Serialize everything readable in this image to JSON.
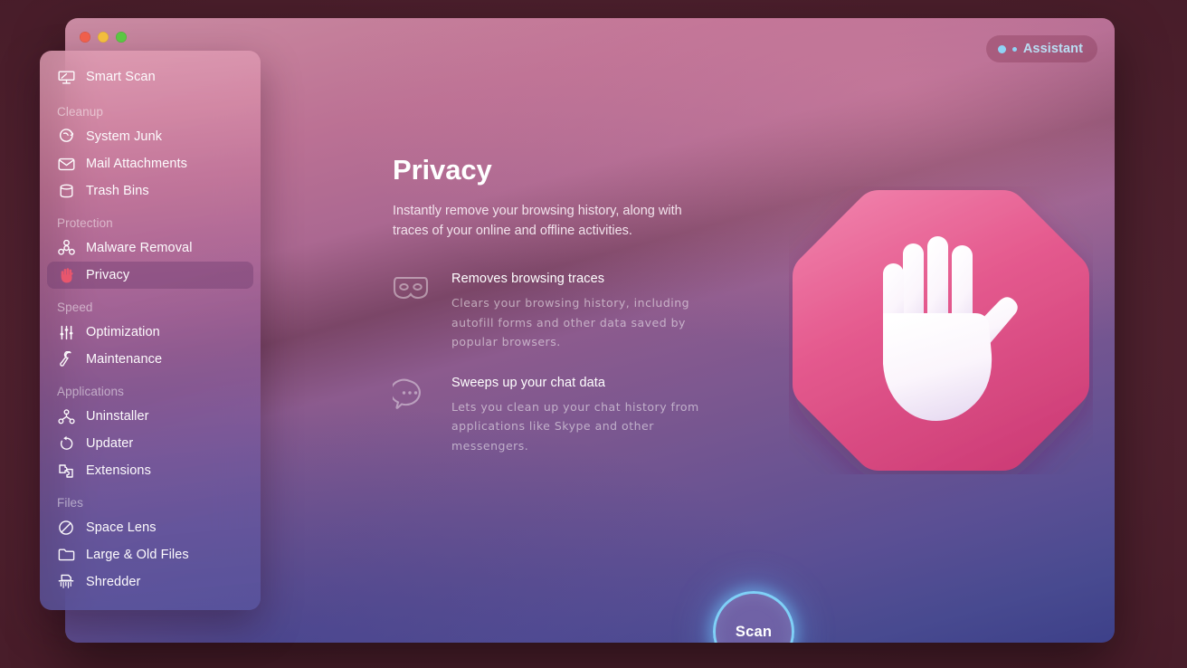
{
  "window": {
    "traffic_lights": [
      {
        "name": "close",
        "color": "#ef5f4c"
      },
      {
        "name": "minimize",
        "color": "#f2bd3e"
      },
      {
        "name": "zoom",
        "color": "#5bc643"
      }
    ]
  },
  "assistant": {
    "label": "Assistant"
  },
  "sidebar": {
    "items": [
      {
        "label": "Smart Scan",
        "icon": "monitor-icon",
        "selected": false,
        "type": "item"
      },
      {
        "label": "Cleanup",
        "type": "section"
      },
      {
        "label": "System Junk",
        "icon": "broom-icon",
        "selected": false,
        "type": "item"
      },
      {
        "label": "Mail Attachments",
        "icon": "envelope-icon",
        "selected": false,
        "type": "item"
      },
      {
        "label": "Trash Bins",
        "icon": "trash-bin-icon",
        "selected": false,
        "type": "item"
      },
      {
        "label": "Protection",
        "type": "section"
      },
      {
        "label": "Malware Removal",
        "icon": "biohazard-icon",
        "selected": false,
        "type": "item"
      },
      {
        "label": "Privacy",
        "icon": "hand-icon",
        "selected": true,
        "type": "item"
      },
      {
        "label": "Speed",
        "type": "section"
      },
      {
        "label": "Optimization",
        "icon": "sliders-icon",
        "selected": false,
        "type": "item"
      },
      {
        "label": "Maintenance",
        "icon": "wrench-icon",
        "selected": false,
        "type": "item"
      },
      {
        "label": "Applications",
        "type": "section"
      },
      {
        "label": "Uninstaller",
        "icon": "app-nodes-icon",
        "selected": false,
        "type": "item"
      },
      {
        "label": "Updater",
        "icon": "refresh-arrow-icon",
        "selected": false,
        "type": "item"
      },
      {
        "label": "Extensions",
        "icon": "puzzle-piece-icon",
        "selected": false,
        "type": "item"
      },
      {
        "label": "Files",
        "type": "section"
      },
      {
        "label": "Space Lens",
        "icon": "circle-slash-icon",
        "selected": false,
        "type": "item"
      },
      {
        "label": "Large & Old Files",
        "icon": "folder-icon",
        "selected": false,
        "type": "item"
      },
      {
        "label": "Shredder",
        "icon": "shredder-icon",
        "selected": false,
        "type": "item"
      }
    ]
  },
  "main": {
    "title": "Privacy",
    "subtitle": "Instantly remove your browsing history, along with traces of your online and offline activities.",
    "features": [
      {
        "icon": "mask-icon",
        "title": "Removes browsing traces",
        "description": "Clears your browsing history, including autofill forms and other data saved by popular browsers."
      },
      {
        "icon": "chat-bubble-icon",
        "title": "Sweeps up your chat data",
        "description": "Lets you clean up your chat history from applications like Skype and other messengers."
      }
    ],
    "hero_icon": "stop-hand-octagon-icon"
  },
  "scan": {
    "label": "Scan"
  },
  "colors": {
    "desktop_background": "#4a1e2b",
    "window_top": "#c98ba2",
    "window_bottom": "#3d4089",
    "accent_blue": "#7fd0f7",
    "assistant_text": "#b9def3",
    "hero_pink": "#e05a8c",
    "selected_row": "#6e3c6e"
  }
}
